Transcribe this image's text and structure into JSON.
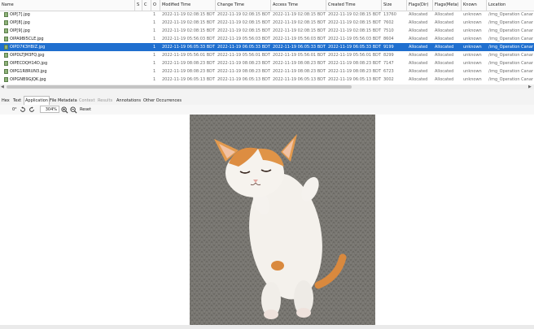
{
  "columns": [
    "Name",
    "S",
    "C",
    "O",
    "Modified Time",
    "Change Time",
    "Access Time",
    "Created Time",
    "Size",
    "Flags(Dir)",
    "Flags(Meta)",
    "Known",
    "Location"
  ],
  "rows": [
    {
      "name": "OIP[7].jpg",
      "o": "1",
      "mtime": "2022-11-19 02:08:15 BDT",
      "ctime": "2022-11-19 02:08:15 BDT",
      "atime": "2022-11-19 02:08:15 BDT",
      "crtime": "2022-11-19 02:08:15 BDT",
      "size": "13760",
      "flags_dir": "Allocated",
      "flags_meta": "Allocated",
      "known": "unknown",
      "location": "/img_Operation Canar"
    },
    {
      "name": "OIP[8].jpg",
      "o": "1",
      "mtime": "2022-11-19 02:08:15 BDT",
      "ctime": "2022-11-19 02:08:15 BDT",
      "atime": "2022-11-19 02:08:15 BDT",
      "crtime": "2022-11-19 02:08:15 BDT",
      "size": "7602",
      "flags_dir": "Allocated",
      "flags_meta": "Allocated",
      "known": "unknown",
      "location": "/img_Operation Canar"
    },
    {
      "name": "OIP[9].jpg",
      "o": "1",
      "mtime": "2022-11-19 02:08:15 BDT",
      "ctime": "2022-11-19 02:08:15 BDT",
      "atime": "2022-11-19 02:08:15 BDT",
      "crtime": "2022-11-19 02:08:15 BDT",
      "size": "7510",
      "flags_dir": "Allocated",
      "flags_meta": "Allocated",
      "known": "unknown",
      "location": "/img_Operation Canar"
    },
    {
      "name": "OIPA9BI5CLE.jpg",
      "o": "1",
      "mtime": "2022-11-19 05:56:03 BDT",
      "ctime": "2022-11-19 05:56:03 BDT",
      "atime": "2022-11-19 05:56:03 BDT",
      "crtime": "2022-11-19 05:56:03 BDT",
      "size": "8604",
      "flags_dir": "Allocated",
      "flags_meta": "Allocated",
      "known": "unknown",
      "location": "/img_Operation Canar"
    },
    {
      "name": "OIPD7K3HBIZ.jpg",
      "o": "1",
      "mtime": "2022-11-19 06:05:33 BDT",
      "ctime": "2022-11-19 06:05:33 BDT",
      "atime": "2022-11-19 06:05:33 BDT",
      "crtime": "2022-11-19 06:05:33 BDT",
      "size": "9199",
      "flags_dir": "Allocated",
      "flags_meta": "Allocated",
      "known": "unknown",
      "location": "/img_Operation Canar",
      "selected": true
    },
    {
      "name": "OIPDLTJM3FQ.jpg",
      "o": "1",
      "mtime": "2022-11-19 05:56:01 BDT",
      "ctime": "2022-11-19 05:56:01 BDT",
      "atime": "2022-11-19 05:56:01 BDT",
      "crtime": "2022-11-19 05:56:01 BDT",
      "size": "8299",
      "flags_dir": "Allocated",
      "flags_meta": "Allocated",
      "known": "unknown",
      "location": "/img_Operation Canar"
    },
    {
      "name": "OIPECDQH14D.jpg",
      "o": "1",
      "mtime": "2022-11-19 08:08:23 BDT",
      "ctime": "2022-11-19 08:08:23 BDT",
      "atime": "2022-11-19 08:08:23 BDT",
      "crtime": "2022-11-19 08:08:23 BDT",
      "size": "7147",
      "flags_dir": "Allocated",
      "flags_meta": "Allocated",
      "known": "unknown",
      "location": "/img_Operation Canar"
    },
    {
      "name": "OIPG1R8RUN3.jpg",
      "o": "1",
      "mtime": "2022-11-19 08:08:23 BDT",
      "ctime": "2022-11-19 08:08:23 BDT",
      "atime": "2022-11-19 08:08:23 BDT",
      "crtime": "2022-11-19 08:08:23 BDT",
      "size": "6723",
      "flags_dir": "Allocated",
      "flags_meta": "Allocated",
      "known": "unknown",
      "location": "/img_Operation Canar"
    },
    {
      "name": "OIPGNB9GJQK.jpg",
      "o": "1",
      "mtime": "2022-11-19 06:05:13 BDT",
      "ctime": "2022-11-19 06:05:13 BDT",
      "atime": "2022-11-19 06:05:13 BDT",
      "crtime": "2022-11-19 06:05:13 BDT",
      "size": "3002",
      "flags_dir": "Allocated",
      "flags_meta": "Allocated",
      "known": "unknown",
      "location": "/img_Operation Canar"
    }
  ],
  "tabs": [
    "Hex",
    "Text",
    "Application",
    "File Metadata",
    "Context",
    "Results",
    "Annotations",
    "Other Occurrences"
  ],
  "active_tab": "Application",
  "disabled_tabs": [
    "Context",
    "Results"
  ],
  "toolbar": {
    "rotation": "0°",
    "zoom": "304%",
    "reset_label": "Reset"
  },
  "colors": {
    "selection": "#1f6fcf",
    "header_bg": "#fafafa",
    "photo_bg": "#777570"
  },
  "icons": [
    "image-file-icon",
    "rotate-left-icon",
    "rotate-right-icon",
    "zoom-in-icon",
    "zoom-out-icon"
  ]
}
